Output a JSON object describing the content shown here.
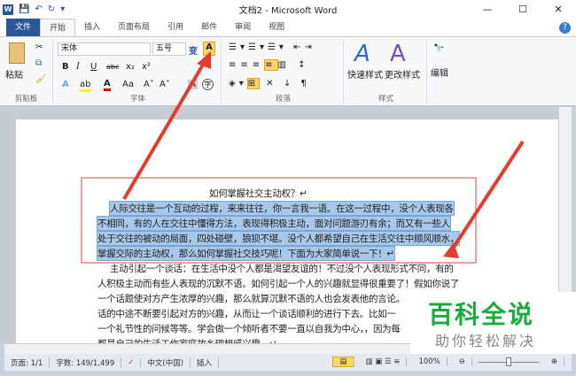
{
  "window": {
    "title": "文档2 - Microsoft Word",
    "minimize": "—",
    "maximize": "☐",
    "close": "✕"
  },
  "quick_access": {
    "word_icon": "W",
    "save": "💾",
    "undo": "↶",
    "redo": "↻",
    "customize": "▾"
  },
  "tabs": [
    "文件",
    "开始",
    "插入",
    "页面布局",
    "引用",
    "邮件",
    "审阅",
    "视图"
  ],
  "ribbon": {
    "clipboard": {
      "paste": "粘贴",
      "label": "剪贴板"
    },
    "font": {
      "font_name": "宋体",
      "font_size": "五号",
      "label": "字体",
      "bold": "B",
      "italic": "I",
      "underline": "U",
      "strike": "abc",
      "sub": "x₂",
      "sup": "x²",
      "phonetic": "变",
      "char_border": "A",
      "grow": "A˄",
      "shrink": "A˅",
      "case": "Aa",
      "effects": "A",
      "highlight": "ab",
      "color": "A",
      "shading": "A",
      "enclose": "字"
    },
    "paragraph": {
      "label": "段落"
    },
    "styles": {
      "quick": "快速样式",
      "change": "更改样式",
      "label": "样式"
    },
    "editing": {
      "label": "编辑"
    }
  },
  "document": {
    "title": "如何掌握社交主动权？↵",
    "selected_lines": [
      "人际交往是一个互动的过程，来来往往，你一言我一语。在这一过程中，没个人表现各",
      "不相同，有的人在交往中懂得方法，表现得积极主动，面对问题游刃有余；而又有一些人",
      "处于交往的被动的局面，四处碰壁，狼狈不堪。没个人都希望自己在生活交往中顺风顺水，",
      "掌握交际的主动权，那么如何掌握社交技巧呢！下面为大家简单说一下！↵"
    ],
    "body_lines": [
      "主动引起一个谈话：在生活中没个人都是渴望友谊的！不过没个人表现形式不同，有的",
      "人积极主动而有些人表现的沉默不语。如何引起一个人的兴趣就显得很重要了！假如你说了",
      "一个话题使对方产生浓厚的兴趣，那么就算沉默不语的人也会发表他的言论。",
      "话的中途不断要引起对方的兴趣，从而让一个谈话顺利的进行下去。比如一",
      "一个礼节性的问候等等。学会做一个倾听者不要一直以自我为中心，，因为每",
      "都是自己的生活工作家庭故乡理想感兴趣。↵"
    ]
  },
  "status": {
    "page": "页面: 1/1",
    "words": "字数: 149/1,499",
    "language": "中文(中国)",
    "mode": "插入",
    "zoom": "100%"
  },
  "watermark": {
    "main": "百科全说",
    "sub": "助你轻松解决"
  }
}
